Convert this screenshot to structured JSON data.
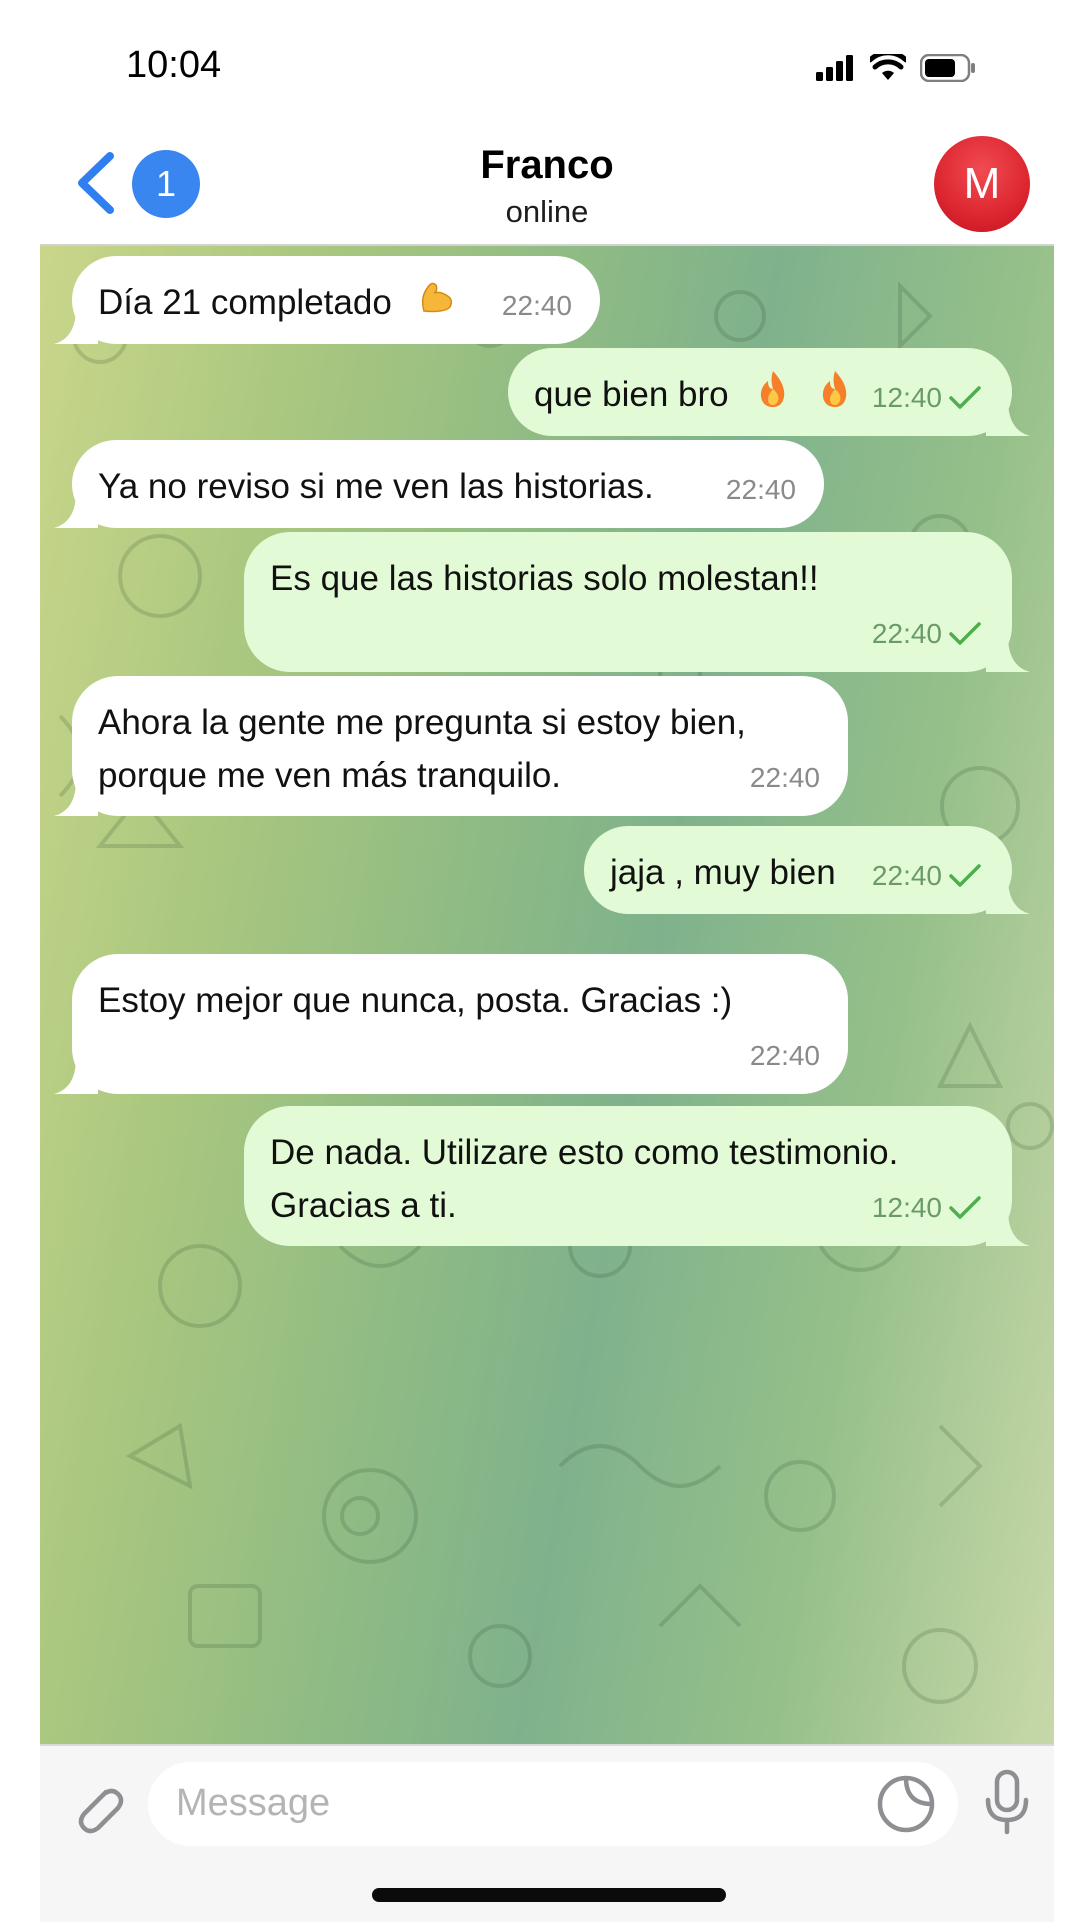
{
  "status_bar": {
    "time": "10:04"
  },
  "header": {
    "back_count": "1",
    "contact_name": "Franco",
    "contact_status": "online",
    "avatar_initial": "M"
  },
  "messages": [
    {
      "direction": "in",
      "text": "Día 21 completado",
      "emoji": "flexed-biceps",
      "time": "22:40"
    },
    {
      "direction": "out",
      "text": "que bien bro",
      "emoji": "fire-fire",
      "time": "12:40",
      "read": true
    },
    {
      "direction": "in",
      "text": "Ya no reviso si me ven las historias.",
      "time": "22:40"
    },
    {
      "direction": "out",
      "text": "Es que las historias solo molestan!!",
      "time": "22:40",
      "read": true
    },
    {
      "direction": "in",
      "text": "Ahora la gente me pregunta si estoy bien,\nporque me ven más tranquilo.",
      "time": "22:40"
    },
    {
      "direction": "out",
      "text": "jaja , muy bien",
      "time": "22:40",
      "read": true
    },
    {
      "direction": "in",
      "text": "Estoy mejor que nunca, posta. Gracias :)",
      "time": "22:40"
    },
    {
      "direction": "out",
      "text": "De nada. Utilizare esto como testimonio.\nGracias a ti.",
      "time": "12:40",
      "read": true
    }
  ],
  "composer": {
    "placeholder": "Message"
  },
  "colors": {
    "accent": "#3a86f0",
    "outgoing_bubble": "#e2fbd6",
    "incoming_bubble": "#ffffff",
    "avatar": "#dc2630"
  }
}
